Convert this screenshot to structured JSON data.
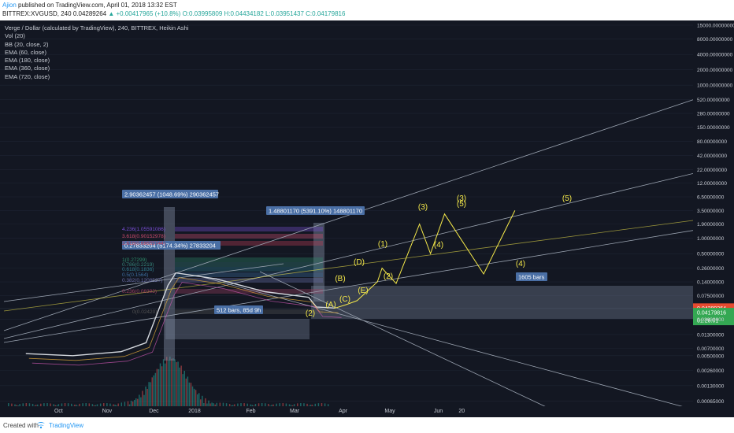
{
  "header": {
    "author": "Ajion",
    "published": "published on TradingView.com, April 01, 2018 13:32 EST",
    "symbol": "BITTREX:XVGUSD, 240",
    "price": "0.04289264",
    "change": "+0.00417965 (+10.8%)",
    "ohlc": "O:0.03995809 H:0.04434182 L:0.03951437 C:0.04179816"
  },
  "legend": [
    "Verge / Dollar (calculated by TradingView), 240, BITTREX, Heikin Ashi",
    "Vol (20)",
    "BB (20, close, 2)",
    "EMA (60, close)",
    "EMA (180, close)",
    "EMA (360, close)",
    "EMA (720, close)"
  ],
  "footer": {
    "created": "Created with",
    "brand": "TradingView"
  },
  "colors": {
    "background": "#131722",
    "wave": "#f5e94a",
    "fib_box": "#7e8aa0",
    "label_bg": "#4a6fa5",
    "price_tag": "#e64a2f",
    "price_tag2": "#34a853"
  },
  "icons": [
    "tradingview-icon"
  ],
  "chart_data": {
    "type": "line",
    "y_scale": "log",
    "y_ticks": [
      "15000.00000000",
      "8000.00000000",
      "4000.00000000",
      "2000.00000000",
      "1000.00000000",
      "520.00000000",
      "280.00000000",
      "150.00000000",
      "80.00000000",
      "42.00000000",
      "22.00000000",
      "12.00000000",
      "6.50000000",
      "3.50000000",
      "1.90000000",
      "1.00000000",
      "0.50000000",
      "0.26000000",
      "0.14000000",
      "0.07500000",
      "0.04289264",
      "0.04179816",
      "0.02600000",
      "0.01300000",
      "0.00700000",
      "0.00500000",
      "0.00260000",
      "0.00130000",
      "0.00065000",
      "0.00029000"
    ],
    "y_tick_highlights": {
      "current": "0.04289264",
      "close": "0.04179816",
      "countdown": "01:28:01"
    },
    "x_ticks": [
      "Oct",
      "Nov",
      "Dec",
      "2018",
      "Feb",
      "Mar",
      "Apr",
      "May",
      "Jun",
      "20"
    ],
    "measure_labels": [
      "2.90362457 (1048.69%) 290362457",
      "0.27833204 (5174.34%) 27833204",
      "1.48801170 (5391.10%) 148801170",
      "512 bars, 85d 9h",
      "1605 bars"
    ],
    "fib_levels": [
      "4.236(1.05591086)",
      "3.618(0.90152978)",
      "2.618(0.68655744)",
      "1(0.27299)",
      "0.786(0.2219)",
      "0.618(0.1836)",
      "0.5(0.1564)",
      "0.382(0.1208527)",
      "0.236(0.08393)",
      "0(0.02420)"
    ],
    "wave_labels": [
      "(1)",
      "(2)",
      "(3)",
      "(4)",
      "(5)",
      "(3)",
      "(4)",
      "(5)",
      "(A)",
      "(B)",
      "(C)",
      "(D)",
      "(E)",
      "(2)"
    ],
    "price_series": {
      "x": [
        "Sep",
        "Oct",
        "Nov",
        "Dec 1",
        "Dec 15",
        "Dec 20",
        "Jan",
        "Feb",
        "Mar",
        "Mar 20",
        "Apr 1"
      ],
      "values": [
        0.0055,
        0.005,
        0.006,
        0.009,
        0.12,
        0.21,
        0.16,
        0.09,
        0.07,
        0.045,
        0.043
      ]
    },
    "wave_path": {
      "x": [
        "Apr 1",
        "Apr 8",
        "Apr 15",
        "Apr 28",
        "May 1",
        "May 10",
        "May 25",
        "Jun 1",
        "Jun 10",
        "Jul 5",
        "Jul 25"
      ],
      "values": [
        0.043,
        0.05,
        0.06,
        0.14,
        0.26,
        0.13,
        1.9,
        0.5,
        3.0,
        0.2,
        3.5
      ]
    }
  }
}
